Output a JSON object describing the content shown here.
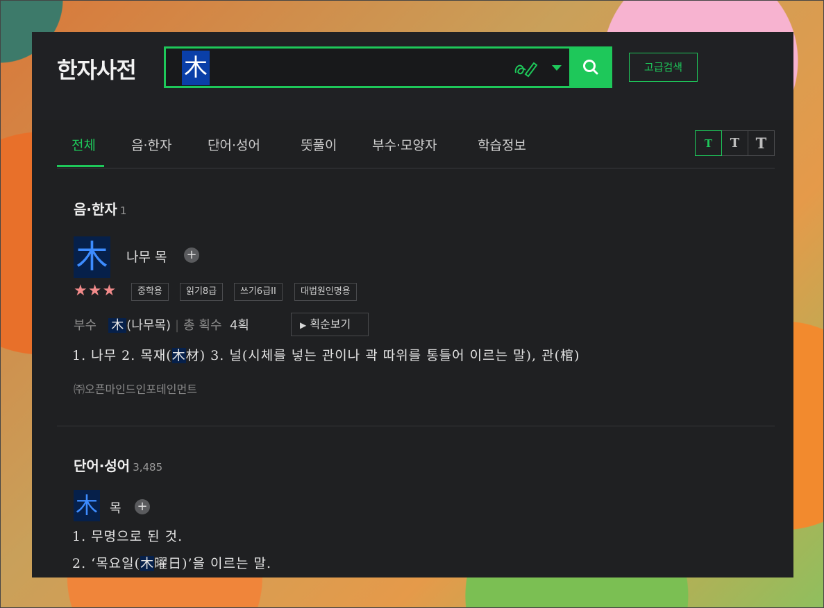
{
  "header": {
    "logo": "한자사전",
    "query": "木",
    "advanced_label": "고급검색"
  },
  "tabs": [
    "전체",
    "음·한자",
    "단어·성어",
    "뜻풀이",
    "부수·모양자",
    "학습정보"
  ],
  "font_sizes": [
    "T",
    "T",
    "T"
  ],
  "hanja_section": {
    "title": "음·한자",
    "count": "1",
    "char": "木",
    "reading": "나무 목",
    "stars": "★★★",
    "badges": [
      "중학용",
      "읽기8급",
      "쓰기6급II",
      "대법원인명용"
    ],
    "radical_label": "부수",
    "radical_char": "木",
    "radical_name": "(나무목)",
    "strokes_label": "총 획수",
    "strokes_value": "4획",
    "stroke_order_label": "획순보기",
    "def_1": "1. 나무  2. 목재(",
    "def_hl": "木",
    "def_2": "材)  3. 널(시체를 넣는 관이나 곽 따위를 통틀어 이르는 말), 관(棺)",
    "copyright": "㈜오픈마인드인포테인먼트"
  },
  "word_section": {
    "title": "단어·성어",
    "count": "3,485",
    "char": "木",
    "reading": "목",
    "def1": "1. 무명으로 된 것.",
    "def2_a": "2. ‘목요일(",
    "def2_hl": "木",
    "def2_b": "曜日)’을 이르는 말."
  },
  "colors": {
    "accent": "#1ec85a",
    "highlight_bg": "#06204a",
    "hanja_blue": "#3d8cff",
    "star": "#f28b8b"
  }
}
